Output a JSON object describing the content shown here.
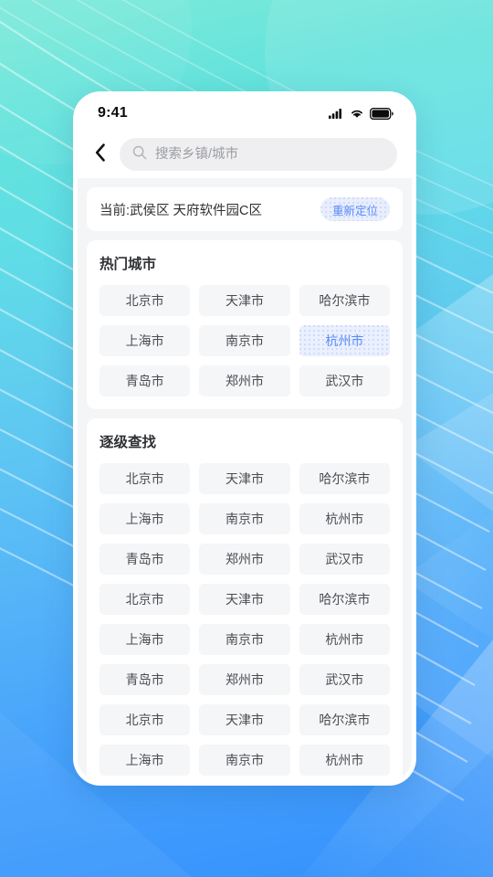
{
  "statusbar": {
    "time": "9:41",
    "signal_icon": "signal-bars-icon",
    "wifi_icon": "wifi-icon",
    "battery_icon": "battery-icon"
  },
  "header": {
    "back_icon": "back-chevron-icon",
    "search_icon": "search-icon",
    "search_placeholder": "搜索乡镇/城市",
    "search_value": ""
  },
  "location": {
    "current_text": "当前:武侯区 天府软件园C区",
    "relocate_label": "重新定位"
  },
  "hot_cities": {
    "title": "热门城市",
    "selected": "杭州市",
    "items": [
      "北京市",
      "天津市",
      "哈尔滨市",
      "上海市",
      "南京市",
      "杭州市",
      "青岛市",
      "郑州市",
      "武汉市"
    ]
  },
  "step_search": {
    "title": "逐级查找",
    "items": [
      "北京市",
      "天津市",
      "哈尔滨市",
      "上海市",
      "南京市",
      "杭州市",
      "青岛市",
      "郑州市",
      "武汉市",
      "北京市",
      "天津市",
      "哈尔滨市",
      "上海市",
      "南京市",
      "杭州市",
      "青岛市",
      "郑州市",
      "武汉市",
      "北京市",
      "天津市",
      "哈尔滨市",
      "上海市",
      "南京市",
      "杭州市"
    ]
  },
  "colors": {
    "accent_blue": "#5a8bf6",
    "chip_bg": "#f5f6f8",
    "chip_selected_bg": "#eaf0fe",
    "page_bg": "#f4f5f6",
    "card_bg": "#ffffff",
    "bg_top": "#7eead9",
    "bg_bottom": "#3491fb"
  }
}
